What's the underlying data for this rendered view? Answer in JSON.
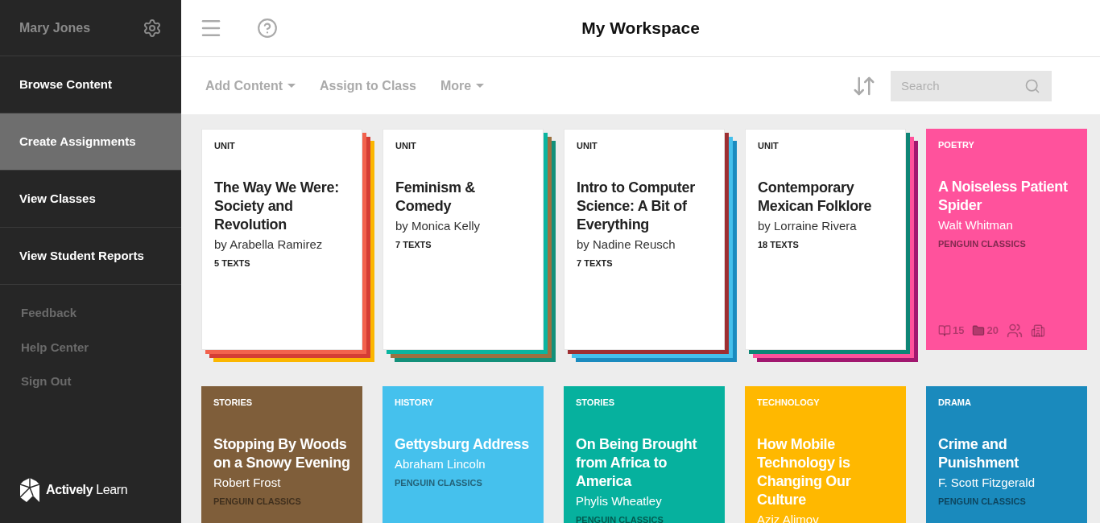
{
  "sidebar": {
    "user": "Mary Jones",
    "nav": [
      {
        "label": "Browse Content",
        "selected": false
      },
      {
        "label": "Create Assignments",
        "selected": true
      },
      {
        "label": "View Classes",
        "selected": false
      },
      {
        "label": "View Student Reports",
        "selected": false
      }
    ],
    "links": [
      "Feedback",
      "Help Center",
      "Sign Out"
    ],
    "logo": {
      "bold": "Actively",
      "light": "Learn"
    }
  },
  "header": {
    "title": "My Workspace"
  },
  "toolbar": {
    "actions": [
      {
        "label": "Add Content",
        "dropdown": true
      },
      {
        "label": "Assign to Class",
        "dropdown": false
      },
      {
        "label": "More",
        "dropdown": true
      }
    ],
    "search": {
      "placeholder": "Search"
    }
  },
  "cards": [
    {
      "kind": "unit",
      "category": "UNIT",
      "title": "The Way We Were: Society and Revolution",
      "author": "by Arabella Ramirez",
      "count": "5 TEXTS",
      "stack": [
        {
          "color": "#f2624d"
        },
        {
          "color": "#d43d35"
        },
        {
          "color": "#fbb600"
        }
      ]
    },
    {
      "kind": "unit",
      "category": "UNIT",
      "title": "Feminism & Comedy",
      "author": "by Monica Kelly",
      "count": "7 TEXTS",
      "stack": [
        {
          "color": "#0ab5a0"
        },
        {
          "color": "#9b7141"
        },
        {
          "color": "#13907a"
        }
      ]
    },
    {
      "kind": "unit",
      "category": "UNIT",
      "title": "Intro to Computer Science: A Bit of Everything",
      "author": "by Nadine Reusch",
      "count": "7 TEXTS",
      "stack": [
        {
          "color": "#9e2f32"
        },
        {
          "color": "#45c0ec"
        },
        {
          "color": "#1b8bbf"
        }
      ]
    },
    {
      "kind": "unit",
      "category": "UNIT",
      "title": "Contemporary Mexican Folklore",
      "author": "by Lorraine Rivera",
      "count": "18 TEXTS",
      "stack": [
        {
          "color": "#0f8576"
        },
        {
          "color": "#ff519b"
        },
        {
          "color": "#a1176f"
        }
      ]
    },
    {
      "kind": "book",
      "category": "POETRY",
      "title": "A Noiseless Patient Spider",
      "author": "Walt Whitman",
      "publisher": "PENGUIN CLASSICS",
      "color": "#ff529c",
      "stats": [
        "15",
        "20"
      ]
    },
    {
      "kind": "book",
      "category": "STORIES",
      "title": "Stopping By Woods on a Snowy Evening",
      "author": "Robert Frost",
      "publisher": "PENGUIN CLASSICS",
      "color": "#7f5e3a"
    },
    {
      "kind": "book",
      "category": "HISTORY",
      "title": "Gettysburg Address",
      "author": "Abraham Lincoln",
      "publisher": "PENGUIN CLASSICS",
      "color": "#45c1ed"
    },
    {
      "kind": "book",
      "category": "STORIES",
      "title": "On Being Brought from Africa to America",
      "author": "Phylis Wheatley",
      "publisher": "PENGUIN CLASSICS",
      "color": "#06b19e"
    },
    {
      "kind": "book",
      "category": "TECHNOLOGY",
      "title": "How Mobile Technology is Changing Our Culture",
      "author": "Aziz Alimov",
      "color": "#ffb800"
    },
    {
      "kind": "book",
      "category": "DRAMA",
      "title": "Crime and Punishment",
      "author": "F. Scott Fitzgerald",
      "publisher": "PENGUIN CLASSICS",
      "color": "#1a8abd"
    }
  ]
}
